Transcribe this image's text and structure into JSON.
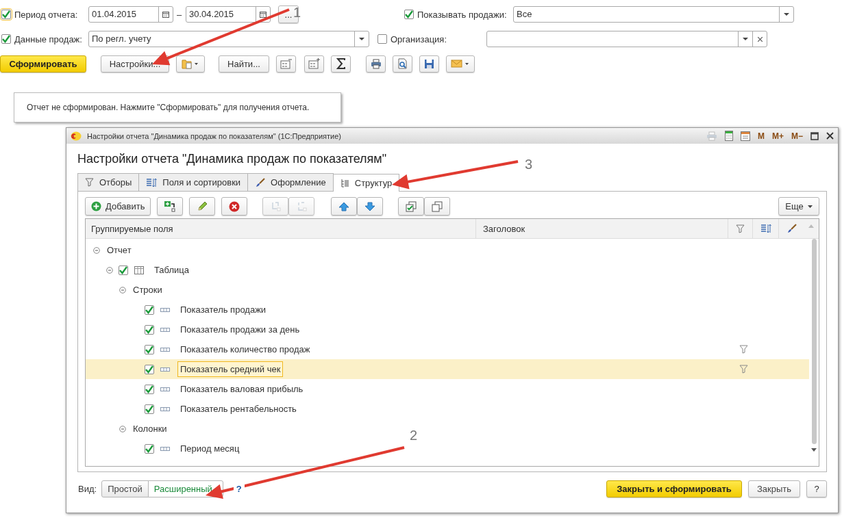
{
  "filters": {
    "period": {
      "checked": true,
      "label": "Период отчета:",
      "from": "01.04.2015",
      "dash": "–",
      "to": "30.04.2015",
      "more": "..."
    },
    "sales_data": {
      "checked": true,
      "label": "Данные продаж:",
      "value": "По регл. учету"
    },
    "show_sales": {
      "checked": true,
      "label": "Показывать продажи:",
      "value": "Все"
    },
    "organization": {
      "checked": false,
      "label": "Организация:"
    }
  },
  "toolbar": {
    "generate": "Сформировать",
    "settings": "Настройки...",
    "find": "Найти..."
  },
  "message": "Отчет не сформирован. Нажмите \"Сформировать\" для получения отчета.",
  "dialog": {
    "title": "Настройки отчета \"Динамика продаж по показателям\"  (1С:Предприятие)",
    "title_buttons": [
      "M",
      "M+",
      "M−"
    ],
    "heading": "Настройки отчета \"Динамика продаж по показателям\"",
    "tabs": [
      {
        "label": "Отборы",
        "kind": "filter",
        "selected": false
      },
      {
        "label": "Поля и сортировки",
        "kind": "fields",
        "selected": false
      },
      {
        "label": "Оформление",
        "kind": "brush",
        "selected": false
      },
      {
        "label": "Структур",
        "kind": "structure",
        "selected": true
      }
    ],
    "add_button": "Добавить",
    "more_button": "Еще",
    "columns": [
      "Группируемые поля",
      "Заголовок"
    ],
    "tree": [
      {
        "label": "Отчет",
        "kind": "group",
        "expanded": true,
        "selected": false,
        "children": [
          {
            "label": "Таблица",
            "kind": "table",
            "checked": true,
            "expanded": true,
            "selected": false,
            "children": [
              {
                "label": "Строки",
                "kind": "group",
                "expanded": true,
                "selected": false,
                "children": [
                  {
                    "label": "Показатель продажи",
                    "kind": "field",
                    "checked": true,
                    "has_filter": false,
                    "selected": false
                  },
                  {
                    "label": "Показатель продажи за день",
                    "kind": "field",
                    "checked": true,
                    "has_filter": false,
                    "selected": false
                  },
                  {
                    "label": "Показатель количество продаж",
                    "kind": "field",
                    "checked": true,
                    "has_filter": true,
                    "selected": false
                  },
                  {
                    "label": "Показатель средний чек",
                    "kind": "field",
                    "checked": true,
                    "has_filter": true,
                    "selected": true
                  },
                  {
                    "label": "Показатель валовая прибыль",
                    "kind": "field",
                    "checked": true,
                    "has_filter": false,
                    "selected": false
                  },
                  {
                    "label": "Показатель рентабельность",
                    "kind": "field",
                    "checked": true,
                    "has_filter": false,
                    "selected": false
                  }
                ]
              },
              {
                "label": "Колонки",
                "kind": "group",
                "expanded": true,
                "selected": false,
                "children": [
                  {
                    "label": "Период месяц",
                    "kind": "field",
                    "checked": true,
                    "has_filter": false,
                    "selected": false
                  }
                ]
              }
            ]
          }
        ]
      }
    ],
    "view_label": "Вид:",
    "view_options": [
      {
        "label": "Простой",
        "selected": false
      },
      {
        "label": "Расширенный",
        "selected": true
      }
    ],
    "help_link": "?",
    "primary_button": "Закрыть и сформировать",
    "close_button": "Закрыть",
    "help_button": "?"
  },
  "annotations": [
    {
      "label": "1"
    },
    {
      "label": "2"
    },
    {
      "label": "3"
    }
  ]
}
